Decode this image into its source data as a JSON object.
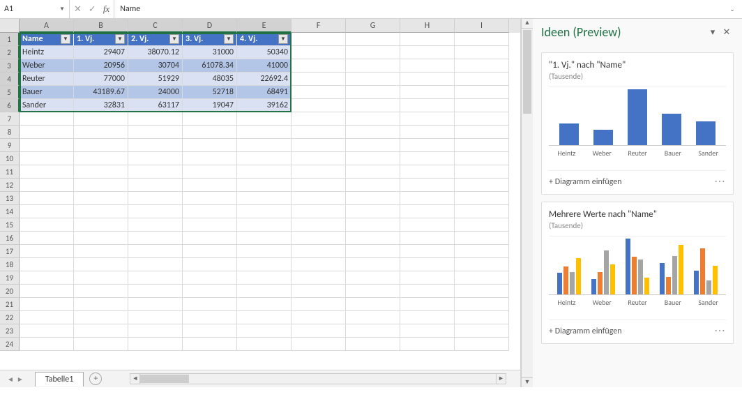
{
  "namebox": "A1",
  "formula": "Name",
  "columns": [
    "A",
    "B",
    "C",
    "D",
    "E",
    "F",
    "G",
    "H",
    "I"
  ],
  "sel_cols": 5,
  "rows_visible": 24,
  "sel_rows": 6,
  "table": {
    "headers": [
      "Name",
      "1. Vj.",
      "2. Vj.",
      "3. Vj.",
      "4. Vj."
    ],
    "data": [
      [
        "Heintz",
        "29407",
        "38070.12",
        "31000",
        "50340"
      ],
      [
        "Weber",
        "20956",
        "30704",
        "61078.34",
        "41000"
      ],
      [
        "Reuter",
        "77000",
        "51929",
        "48035",
        "22692.4"
      ],
      [
        "Bauer",
        "43189.67",
        "24000",
        "52718",
        "68491"
      ],
      [
        "Sander",
        "32831",
        "63117",
        "19047",
        "39162"
      ]
    ]
  },
  "sheet_tab": "Tabelle1",
  "ideas": {
    "title": "Ideen (Preview)",
    "insert_label": "Diagramm einfügen",
    "cards": [
      {
        "title": "\"1. Vj.\" nach \"Name\"",
        "sub": "(Tausende)"
      },
      {
        "title": "Mehrere Werte nach \"Name\"",
        "sub": "(Tausende)"
      }
    ]
  },
  "chart_data": [
    {
      "type": "bar",
      "title": "\"1. Vj.\" nach \"Name\"",
      "subtitle": "(Tausende)",
      "categories": [
        "Heintz",
        "Weber",
        "Reuter",
        "Bauer",
        "Sander"
      ],
      "values": [
        29.4,
        21.0,
        77.0,
        43.2,
        32.8
      ],
      "ylabel": "(Tausende)"
    },
    {
      "type": "bar",
      "title": "Mehrere Werte nach \"Name\"",
      "subtitle": "(Tausende)",
      "categories": [
        "Heintz",
        "Weber",
        "Reuter",
        "Bauer",
        "Sander"
      ],
      "series": [
        {
          "name": "1. Vj.",
          "values": [
            29.4,
            21.0,
            77.0,
            43.2,
            32.8
          ]
        },
        {
          "name": "2. Vj.",
          "values": [
            38.1,
            30.7,
            51.9,
            24.0,
            63.1
          ]
        },
        {
          "name": "3. Vj.",
          "values": [
            31.0,
            61.1,
            48.0,
            52.7,
            19.0
          ]
        },
        {
          "name": "4. Vj.",
          "values": [
            50.3,
            41.0,
            22.7,
            68.5,
            39.2
          ]
        }
      ],
      "ylabel": "(Tausende)"
    }
  ]
}
